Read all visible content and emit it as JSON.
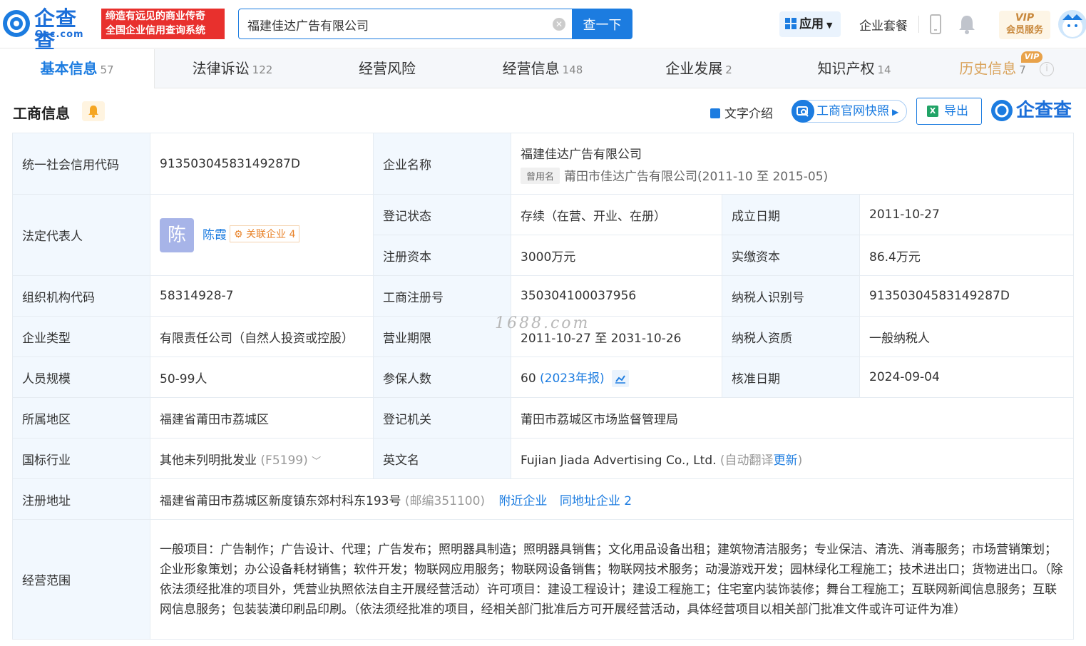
{
  "header": {
    "logo_text": "企查查",
    "logo_sub": "Qcc.com",
    "slogan_line1": "缔造有远见的商业传奇",
    "slogan_line2": "全国企业信用查询系统",
    "search_value": "福建佳达广告有限公司",
    "search_button": "查一下",
    "app_label": "应用",
    "suite_label": "企业套餐",
    "vip_line1": "VIP",
    "vip_line2": "会员服务"
  },
  "tabs": [
    {
      "label": "基本信息",
      "count": "57"
    },
    {
      "label": "法律诉讼",
      "count": "122"
    },
    {
      "label": "经营风险",
      "count": ""
    },
    {
      "label": "经营信息",
      "count": "148"
    },
    {
      "label": "企业发展",
      "count": "2"
    },
    {
      "label": "知识产权",
      "count": "14"
    },
    {
      "label": "历史信息",
      "count": "7"
    }
  ],
  "vip_tag": "VIP",
  "section": {
    "title": "工商信息",
    "text_intro": "文字介绍",
    "snapshot": "工商官网快照",
    "export": "导出",
    "brand": "企查查"
  },
  "info": {
    "credit_code_label": "统一社会信用代码",
    "credit_code": "91350304583149287D",
    "company_name_label": "企业名称",
    "company_name": "福建佳达广告有限公司",
    "former_name_tag": "曾用名",
    "former_name": "莆田市佳达广告有限公司",
    "former_period": "(2011-10 至 2015-05)",
    "legal_rep_label": "法定代表人",
    "legal_rep_avatar": "陈",
    "legal_rep": "陈霞",
    "related_label": "关联企业",
    "related_count": "4",
    "reg_status_label": "登记状态",
    "reg_status": "存续（在营、开业、在册）",
    "established_label": "成立日期",
    "established": "2011-10-27",
    "reg_capital_label": "注册资本",
    "reg_capital": "3000万元",
    "paid_capital_label": "实缴资本",
    "paid_capital": "86.4万元",
    "org_code_label": "组织机构代码",
    "org_code": "58314928-7",
    "biz_reg_no_label": "工商注册号",
    "biz_reg_no": "350304100037956",
    "taxpayer_id_label": "纳税人识别号",
    "taxpayer_id": "91350304583149287D",
    "company_type_label": "企业类型",
    "company_type": "有限责任公司（自然人投资或控股）",
    "biz_term_label": "营业期限",
    "biz_term": "2011-10-27 至 2031-10-26",
    "taxpayer_qual_label": "纳税人资质",
    "taxpayer_qual": "一般纳税人",
    "staff_size_label": "人员规模",
    "staff_size": "50-99人",
    "insured_label": "参保人数",
    "insured": "60",
    "insured_report": "(2023年报)",
    "approval_date_label": "核准日期",
    "approval_date": "2024-09-04",
    "region_label": "所属地区",
    "region": "福建省莆田市荔城区",
    "reg_authority_label": "登记机关",
    "reg_authority": "莆田市荔城区市场监督管理局",
    "industry_label": "国标行业",
    "industry": "其他未列明批发业",
    "industry_code": "(F5199)",
    "english_name_label": "英文名",
    "english_name": "Fujian Jiada Advertising Co., Ltd.",
    "auto_translate": "(自动翻译",
    "update_link": "更新",
    "close_paren": ")",
    "address_label": "注册地址",
    "address": "福建省莆田市荔城区新度镇东郊村科东193号",
    "postcode": "(邮编351100)",
    "nearby_link": "附近企业",
    "same_addr_link": "同地址企业 2",
    "scope_label": "经营范围",
    "scope": "一般项目：广告制作；广告设计、代理；广告发布；照明器具制造；照明器具销售；文化用品设备出租；建筑物清洁服务；专业保洁、清洗、消毒服务；市场营销策划；企业形象策划；办公设备耗材销售；软件开发；物联网应用服务；物联网设备销售；物联网技术服务；动漫游戏开发；园林绿化工程施工；技术进出口；货物进出口。（除依法须经批准的项目外，凭营业执照依法自主开展经营活动）许可项目：建设工程设计；建设工程施工；住宅室内装饰装修；舞台工程施工；互联网新闻信息服务；互联网信息服务；包装装潢印刷品印刷。（依法须经批准的项目，经相关部门批准后方可开展经营活动，具体经营项目以相关部门批准文件或许可证件为准）"
  },
  "watermark": "1688.com",
  "colors": {
    "brand": "#1c7ce0",
    "slogan": "#e8302d",
    "label_bg": "#f2f8fe"
  }
}
